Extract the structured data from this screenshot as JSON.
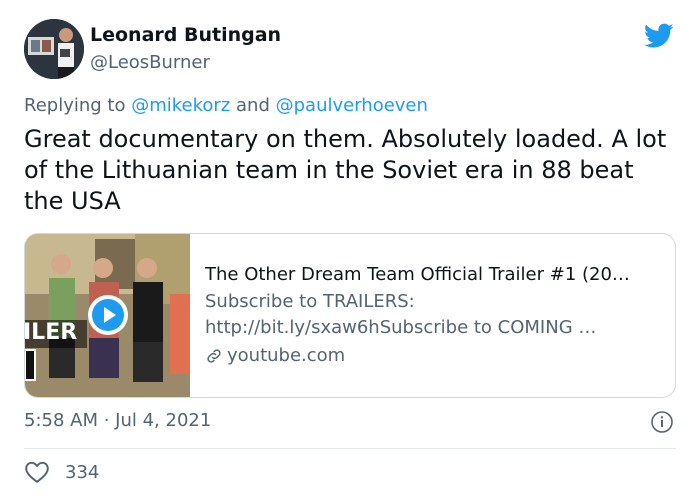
{
  "author": {
    "display_name": "Leonard Butingan",
    "handle": "@LeosBurner",
    "avatar_icon": "user-avatar"
  },
  "brand": {
    "icon": "twitter-bird-icon",
    "color": "#1d9bf0"
  },
  "reply": {
    "prefix": "Replying to",
    "mention1": "@mikekorz",
    "joiner": "and",
    "mention2": "@paulverhoeven"
  },
  "tweet": {
    "text": "Great documentary on them. Absolutely loaded. A lot of the Lithuanian team in the Soviet era in 88 beat the USA"
  },
  "link_card": {
    "title": "The Other Dream Team Official Trailer #1 (20…",
    "description_line1": "Subscribe to TRAILERS:",
    "description_line2": "http://bit.ly/sxaw6hSubscribe to COMING …",
    "domain": "youtube.com",
    "thumbnail_overlay_text": "ILER",
    "play_icon": "play-icon",
    "link_icon": "link-icon"
  },
  "meta": {
    "timestamp": "5:58 AM · Jul 4, 2021",
    "info_icon": "info-icon"
  },
  "engagement": {
    "likes": "334",
    "like_icon": "heart-icon"
  },
  "colors": {
    "text": "#0f1419",
    "secondary": "#536471",
    "accent": "#1d9bf0",
    "border": "#cfd9de"
  }
}
